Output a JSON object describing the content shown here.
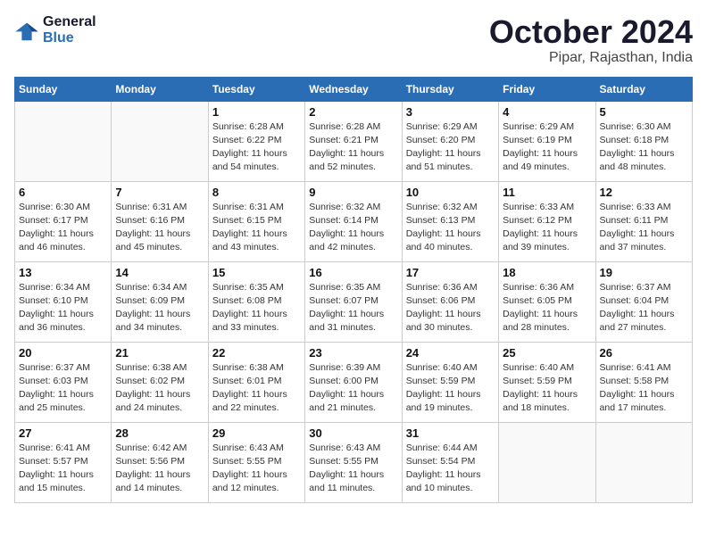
{
  "header": {
    "logo_line1": "General",
    "logo_line2": "Blue",
    "month": "October 2024",
    "location": "Pipar, Rajasthan, India"
  },
  "weekdays": [
    "Sunday",
    "Monday",
    "Tuesday",
    "Wednesday",
    "Thursday",
    "Friday",
    "Saturday"
  ],
  "weeks": [
    [
      {
        "day": "",
        "detail": ""
      },
      {
        "day": "",
        "detail": ""
      },
      {
        "day": "1",
        "detail": "Sunrise: 6:28 AM\nSunset: 6:22 PM\nDaylight: 11 hours and 54 minutes."
      },
      {
        "day": "2",
        "detail": "Sunrise: 6:28 AM\nSunset: 6:21 PM\nDaylight: 11 hours and 52 minutes."
      },
      {
        "day": "3",
        "detail": "Sunrise: 6:29 AM\nSunset: 6:20 PM\nDaylight: 11 hours and 51 minutes."
      },
      {
        "day": "4",
        "detail": "Sunrise: 6:29 AM\nSunset: 6:19 PM\nDaylight: 11 hours and 49 minutes."
      },
      {
        "day": "5",
        "detail": "Sunrise: 6:30 AM\nSunset: 6:18 PM\nDaylight: 11 hours and 48 minutes."
      }
    ],
    [
      {
        "day": "6",
        "detail": "Sunrise: 6:30 AM\nSunset: 6:17 PM\nDaylight: 11 hours and 46 minutes."
      },
      {
        "day": "7",
        "detail": "Sunrise: 6:31 AM\nSunset: 6:16 PM\nDaylight: 11 hours and 45 minutes."
      },
      {
        "day": "8",
        "detail": "Sunrise: 6:31 AM\nSunset: 6:15 PM\nDaylight: 11 hours and 43 minutes."
      },
      {
        "day": "9",
        "detail": "Sunrise: 6:32 AM\nSunset: 6:14 PM\nDaylight: 11 hours and 42 minutes."
      },
      {
        "day": "10",
        "detail": "Sunrise: 6:32 AM\nSunset: 6:13 PM\nDaylight: 11 hours and 40 minutes."
      },
      {
        "day": "11",
        "detail": "Sunrise: 6:33 AM\nSunset: 6:12 PM\nDaylight: 11 hours and 39 minutes."
      },
      {
        "day": "12",
        "detail": "Sunrise: 6:33 AM\nSunset: 6:11 PM\nDaylight: 11 hours and 37 minutes."
      }
    ],
    [
      {
        "day": "13",
        "detail": "Sunrise: 6:34 AM\nSunset: 6:10 PM\nDaylight: 11 hours and 36 minutes."
      },
      {
        "day": "14",
        "detail": "Sunrise: 6:34 AM\nSunset: 6:09 PM\nDaylight: 11 hours and 34 minutes."
      },
      {
        "day": "15",
        "detail": "Sunrise: 6:35 AM\nSunset: 6:08 PM\nDaylight: 11 hours and 33 minutes."
      },
      {
        "day": "16",
        "detail": "Sunrise: 6:35 AM\nSunset: 6:07 PM\nDaylight: 11 hours and 31 minutes."
      },
      {
        "day": "17",
        "detail": "Sunrise: 6:36 AM\nSunset: 6:06 PM\nDaylight: 11 hours and 30 minutes."
      },
      {
        "day": "18",
        "detail": "Sunrise: 6:36 AM\nSunset: 6:05 PM\nDaylight: 11 hours and 28 minutes."
      },
      {
        "day": "19",
        "detail": "Sunrise: 6:37 AM\nSunset: 6:04 PM\nDaylight: 11 hours and 27 minutes."
      }
    ],
    [
      {
        "day": "20",
        "detail": "Sunrise: 6:37 AM\nSunset: 6:03 PM\nDaylight: 11 hours and 25 minutes."
      },
      {
        "day": "21",
        "detail": "Sunrise: 6:38 AM\nSunset: 6:02 PM\nDaylight: 11 hours and 24 minutes."
      },
      {
        "day": "22",
        "detail": "Sunrise: 6:38 AM\nSunset: 6:01 PM\nDaylight: 11 hours and 22 minutes."
      },
      {
        "day": "23",
        "detail": "Sunrise: 6:39 AM\nSunset: 6:00 PM\nDaylight: 11 hours and 21 minutes."
      },
      {
        "day": "24",
        "detail": "Sunrise: 6:40 AM\nSunset: 5:59 PM\nDaylight: 11 hours and 19 minutes."
      },
      {
        "day": "25",
        "detail": "Sunrise: 6:40 AM\nSunset: 5:59 PM\nDaylight: 11 hours and 18 minutes."
      },
      {
        "day": "26",
        "detail": "Sunrise: 6:41 AM\nSunset: 5:58 PM\nDaylight: 11 hours and 17 minutes."
      }
    ],
    [
      {
        "day": "27",
        "detail": "Sunrise: 6:41 AM\nSunset: 5:57 PM\nDaylight: 11 hours and 15 minutes."
      },
      {
        "day": "28",
        "detail": "Sunrise: 6:42 AM\nSunset: 5:56 PM\nDaylight: 11 hours and 14 minutes."
      },
      {
        "day": "29",
        "detail": "Sunrise: 6:43 AM\nSunset: 5:55 PM\nDaylight: 11 hours and 12 minutes."
      },
      {
        "day": "30",
        "detail": "Sunrise: 6:43 AM\nSunset: 5:55 PM\nDaylight: 11 hours and 11 minutes."
      },
      {
        "day": "31",
        "detail": "Sunrise: 6:44 AM\nSunset: 5:54 PM\nDaylight: 11 hours and 10 minutes."
      },
      {
        "day": "",
        "detail": ""
      },
      {
        "day": "",
        "detail": ""
      }
    ]
  ]
}
